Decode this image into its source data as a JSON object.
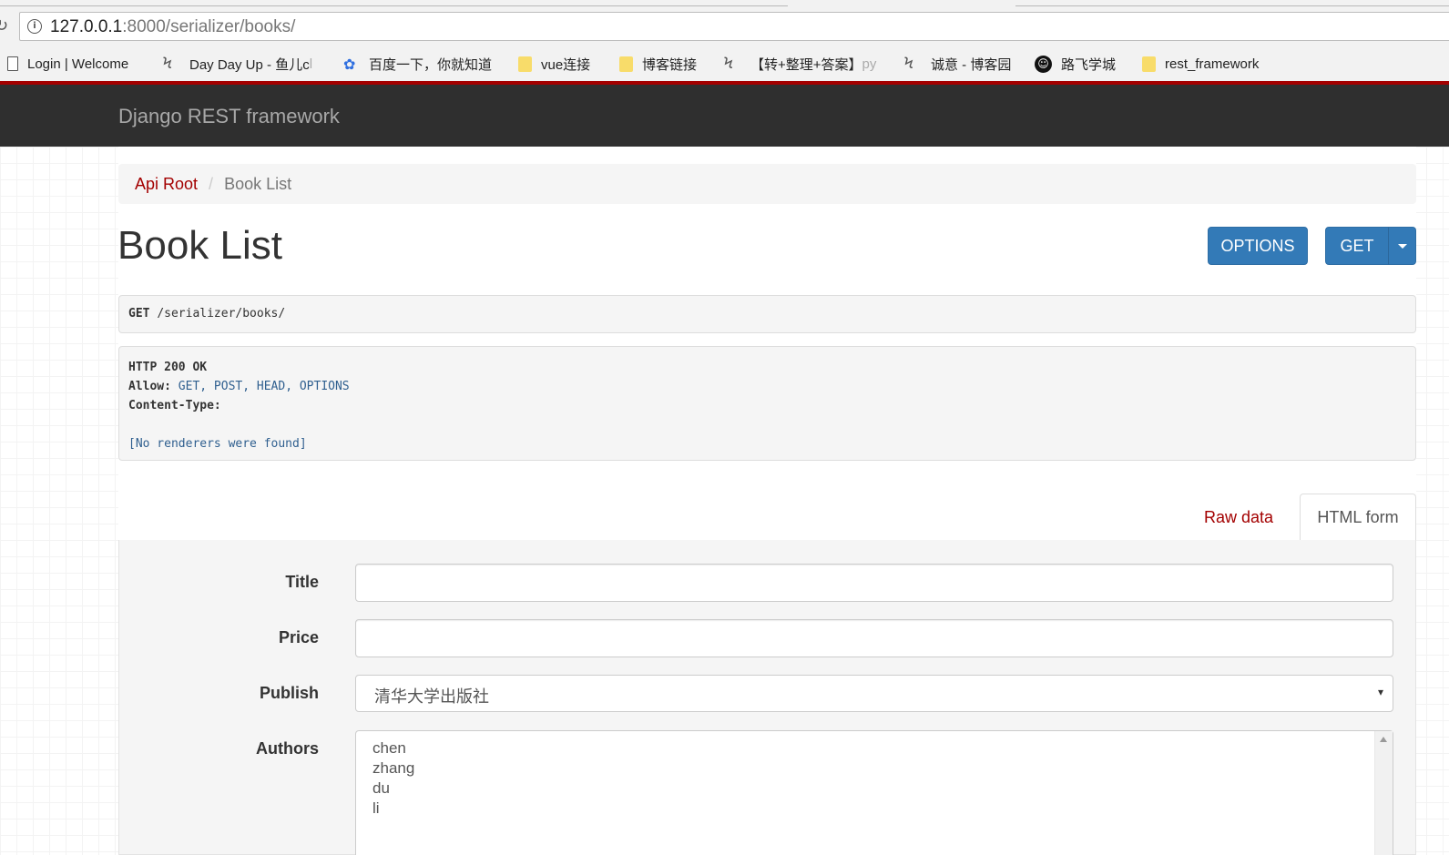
{
  "browser": {
    "url_host": "127.0.0.1",
    "url_rest": ":8000/serializer/books/",
    "bookmarks": [
      {
        "label": "Login | Welcome",
        "icon": "page-icon"
      },
      {
        "label": "Day Day Up - 鱼儿c",
        "fade": "l",
        "icon": "swirl-icon"
      },
      {
        "label": "百度一下，你就知道",
        "icon": "paw-icon"
      },
      {
        "label": "vue连接",
        "icon": "folder-icon"
      },
      {
        "label": "博客链接",
        "icon": "folder-icon"
      },
      {
        "label": "【转+整理+答案】",
        "fade": "py",
        "icon": "swirl-icon"
      },
      {
        "label": "诚意 - 博客园",
        "icon": "swirl-icon"
      },
      {
        "label": "路飞学城",
        "icon": "runner-icon"
      },
      {
        "label": "rest_framework",
        "icon": "folder-icon"
      }
    ]
  },
  "navbar": {
    "brand": "Django REST framework"
  },
  "breadcrumb": {
    "root": "Api Root",
    "separator": "/",
    "current": "Book List"
  },
  "page": {
    "title": "Book List"
  },
  "actions": {
    "options_label": "OPTIONS",
    "get_label": "GET"
  },
  "request": {
    "method": "GET",
    "path": "/serializer/books/"
  },
  "response": {
    "status": "HTTP 200 OK",
    "allow_label": "Allow:",
    "allow_value": "GET, POST, HEAD, OPTIONS",
    "content_type_label": "Content-Type:",
    "body": "[No renderers were found]"
  },
  "tabs": {
    "raw": "Raw data",
    "html": "HTML form"
  },
  "form": {
    "title_label": "Title",
    "title_value": "",
    "price_label": "Price",
    "price_value": "",
    "publish_label": "Publish",
    "publish_selected": "清华大学出版社",
    "authors_label": "Authors",
    "authors_options": [
      "chen",
      "zhang",
      "du",
      "li"
    ]
  },
  "colors": {
    "brand_red": "#a30000",
    "navbar": "#2f2f2f",
    "button_blue": "#337ab7"
  }
}
